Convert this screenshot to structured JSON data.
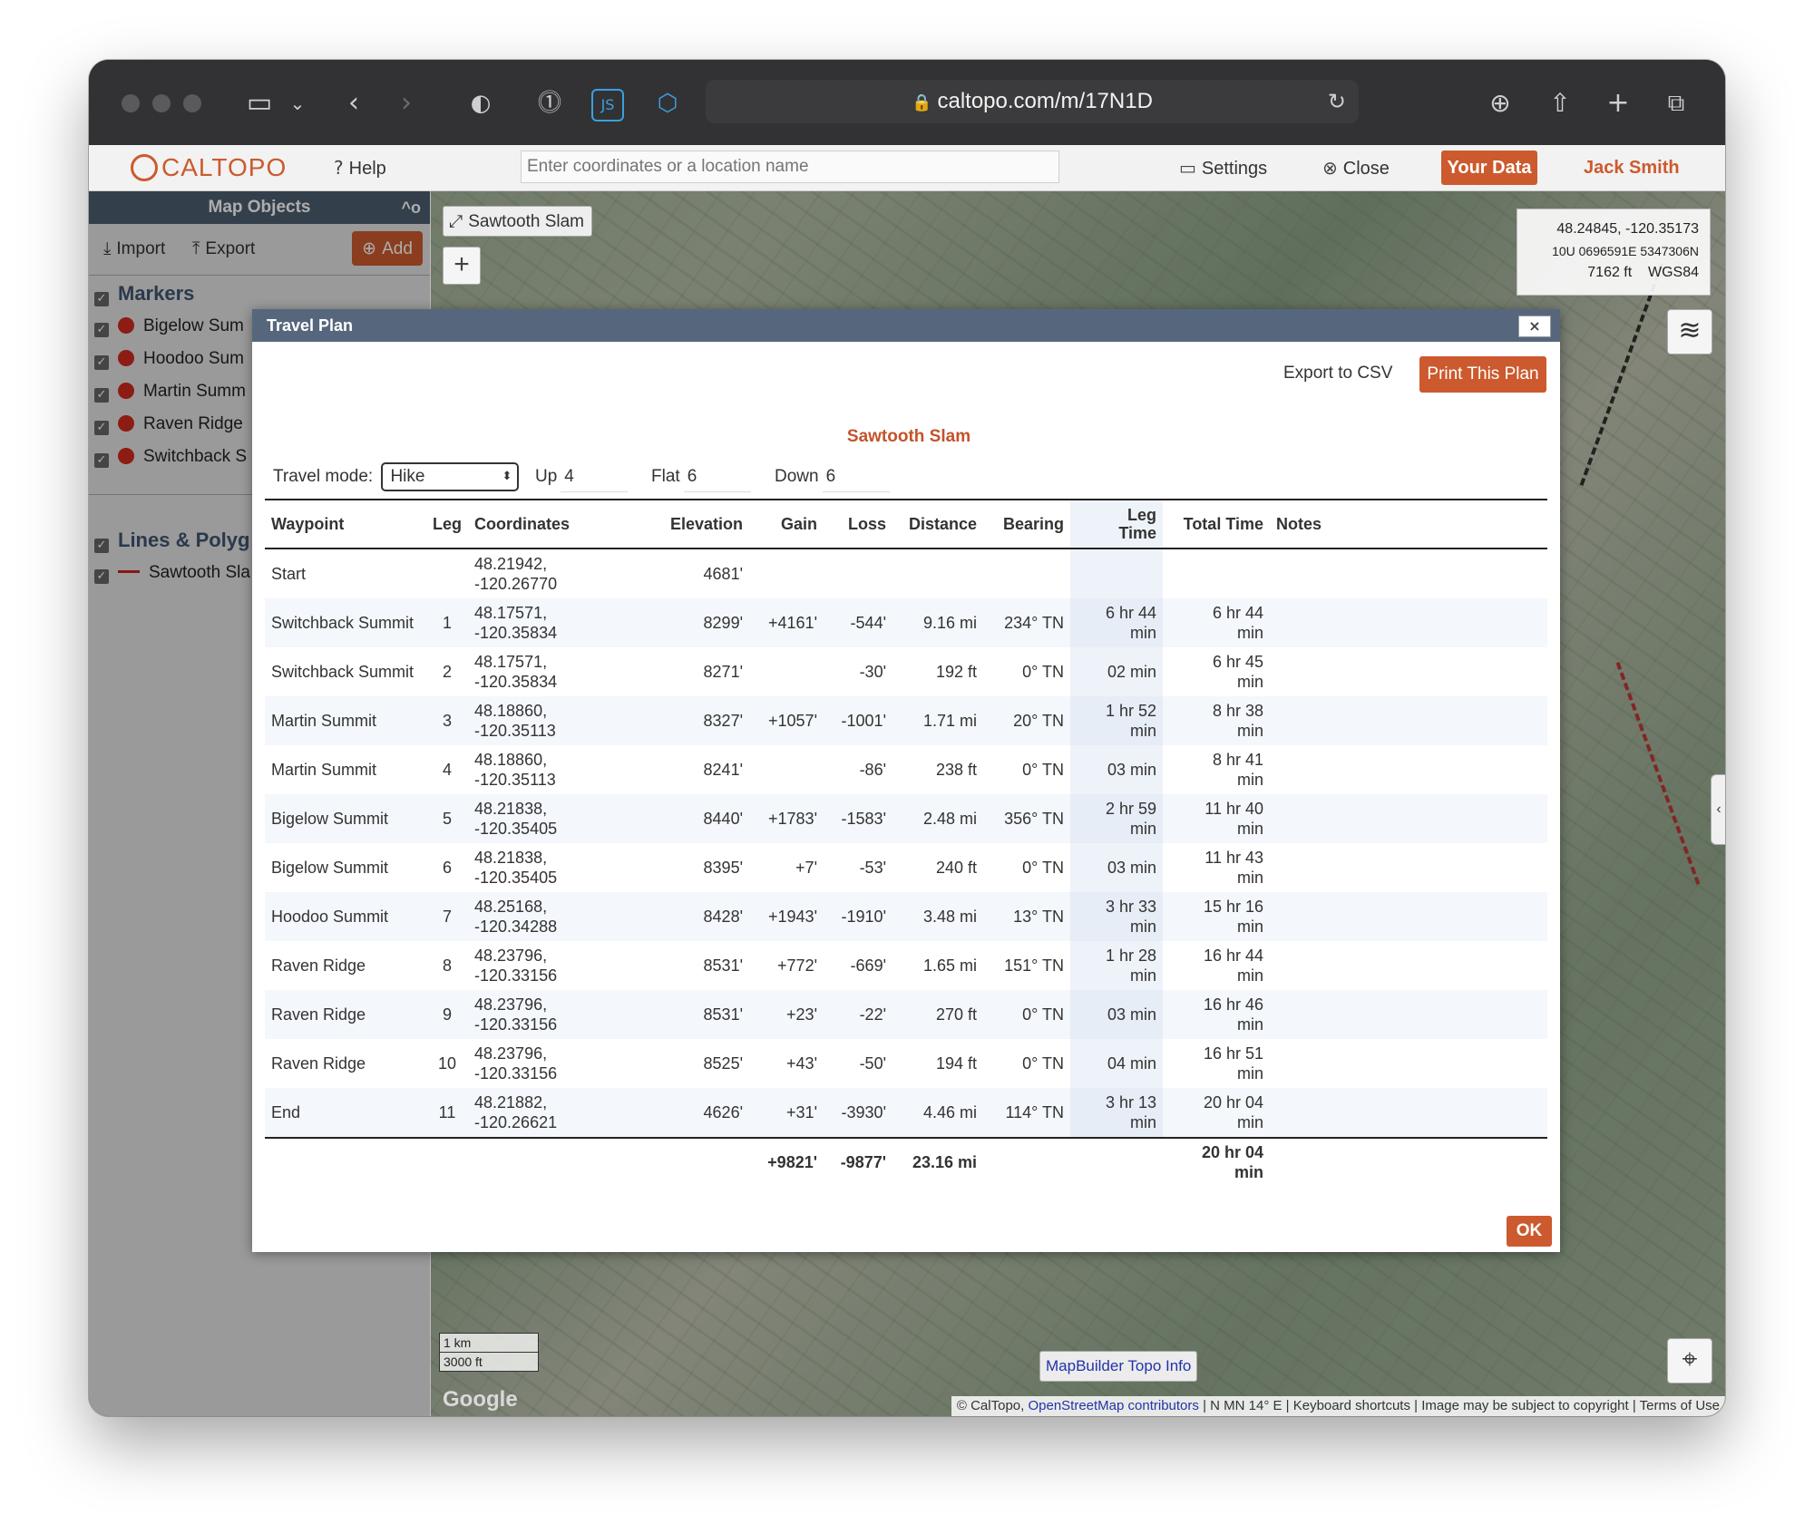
{
  "browser": {
    "url": "caltopo.com/m/17N1D"
  },
  "header": {
    "logo": "CALTOPO",
    "help": "Help",
    "search_placeholder": "Enter coordinates or a location name",
    "settings": "Settings",
    "close": "Close",
    "your_data": "Your Data",
    "user": "Jack Smith"
  },
  "sidebar": {
    "title": "Map Objects",
    "collapse": "^o",
    "import": "Import",
    "export": "Export",
    "add": "Add",
    "markers_heading": "Markers",
    "markers": [
      "Bigelow Sum",
      "Hoodoo Sum",
      "Martin Summ",
      "Raven Ridge",
      "Switchback S"
    ],
    "lines_heading": "Lines & Polyg",
    "lines": [
      "Sawtooth Sla"
    ]
  },
  "map": {
    "title_chip": "Sawtooth Slam",
    "zoom_in": "+",
    "coords": {
      "latlng": "48.24845, -120.35173",
      "utm": "10U 0696591E 5347306N",
      "elev": "7162 ft",
      "datum": "WGS84"
    },
    "scale_km": "1 km",
    "scale_ft": "3000 ft",
    "google": "Google",
    "mapbuilder": "MapBuilder Topo Info",
    "attribution": {
      "caltopo": "© CalTopo,",
      "osm": "OpenStreetMap contributors",
      "declination": "N MN 14° E",
      "keyboard": "Keyboard shortcuts",
      "copyright": "Image may be subject to copyright",
      "terms": "Terms of Use"
    }
  },
  "modal": {
    "title": "Travel Plan",
    "close": "×",
    "export_csv": "Export to CSV",
    "print": "Print This Plan",
    "plan_title": "Sawtooth Slam",
    "travel_mode_label": "Travel mode:",
    "travel_mode": "Hike",
    "up_label": "Up",
    "up": "4",
    "flat_label": "Flat",
    "flat": "6",
    "down_label": "Down",
    "down": "6",
    "ok": "OK",
    "columns": {
      "waypoint": "Waypoint",
      "leg": "Leg",
      "coordinates": "Coordinates",
      "elevation": "Elevation",
      "gain": "Gain",
      "loss": "Loss",
      "distance": "Distance",
      "bearing": "Bearing",
      "leg_time_1": "Leg",
      "leg_time_2": "Time",
      "total_time": "Total Time",
      "notes": "Notes"
    },
    "rows": [
      {
        "waypoint": "Start",
        "leg": "",
        "lat": "48.21942,",
        "lng": "-120.26770",
        "elev": "4681'",
        "gain": "",
        "loss": "",
        "dist": "",
        "bearing": "",
        "leg_time_1": "",
        "leg_time_2": "",
        "total_1": "",
        "total_2": ""
      },
      {
        "waypoint": "Switchback Summit",
        "leg": "1",
        "lat": "48.17571,",
        "lng": "-120.35834",
        "elev": "8299'",
        "gain": "+4161'",
        "loss": "-544'",
        "dist": "9.16 mi",
        "bearing": "234° TN",
        "leg_time_1": "6 hr 44",
        "leg_time_2": "min",
        "total_1": "6 hr 44",
        "total_2": "min"
      },
      {
        "waypoint": "Switchback Summit",
        "leg": "2",
        "lat": "48.17571,",
        "lng": "-120.35834",
        "elev": "8271'",
        "gain": "",
        "loss": "-30'",
        "dist": "192 ft",
        "bearing": "0° TN",
        "leg_time_1": "02 min",
        "leg_time_2": "",
        "total_1": "6 hr 45",
        "total_2": "min"
      },
      {
        "waypoint": "Martin Summit",
        "leg": "3",
        "lat": "48.18860,",
        "lng": "-120.35113",
        "elev": "8327'",
        "gain": "+1057'",
        "loss": "-1001'",
        "dist": "1.71 mi",
        "bearing": "20° TN",
        "leg_time_1": "1 hr 52",
        "leg_time_2": "min",
        "total_1": "8 hr 38",
        "total_2": "min"
      },
      {
        "waypoint": "Martin Summit",
        "leg": "4",
        "lat": "48.18860,",
        "lng": "-120.35113",
        "elev": "8241'",
        "gain": "",
        "loss": "-86'",
        "dist": "238 ft",
        "bearing": "0° TN",
        "leg_time_1": "03 min",
        "leg_time_2": "",
        "total_1": "8 hr 41",
        "total_2": "min"
      },
      {
        "waypoint": "Bigelow Summit",
        "leg": "5",
        "lat": "48.21838,",
        "lng": "-120.35405",
        "elev": "8440'",
        "gain": "+1783'",
        "loss": "-1583'",
        "dist": "2.48 mi",
        "bearing": "356° TN",
        "leg_time_1": "2 hr 59",
        "leg_time_2": "min",
        "total_1": "11 hr 40",
        "total_2": "min"
      },
      {
        "waypoint": "Bigelow Summit",
        "leg": "6",
        "lat": "48.21838,",
        "lng": "-120.35405",
        "elev": "8395'",
        "gain": "+7'",
        "loss": "-53'",
        "dist": "240 ft",
        "bearing": "0° TN",
        "leg_time_1": "03 min",
        "leg_time_2": "",
        "total_1": "11 hr 43",
        "total_2": "min"
      },
      {
        "waypoint": "Hoodoo Summit",
        "leg": "7",
        "lat": "48.25168,",
        "lng": "-120.34288",
        "elev": "8428'",
        "gain": "+1943'",
        "loss": "-1910'",
        "dist": "3.48 mi",
        "bearing": "13° TN",
        "leg_time_1": "3 hr 33",
        "leg_time_2": "min",
        "total_1": "15 hr 16",
        "total_2": "min"
      },
      {
        "waypoint": "Raven Ridge",
        "leg": "8",
        "lat": "48.23796,",
        "lng": "-120.33156",
        "elev": "8531'",
        "gain": "+772'",
        "loss": "-669'",
        "dist": "1.65 mi",
        "bearing": "151° TN",
        "leg_time_1": "1 hr 28",
        "leg_time_2": "min",
        "total_1": "16 hr 44",
        "total_2": "min"
      },
      {
        "waypoint": "Raven Ridge",
        "leg": "9",
        "lat": "48.23796,",
        "lng": "-120.33156",
        "elev": "8531'",
        "gain": "+23'",
        "loss": "-22'",
        "dist": "270 ft",
        "bearing": "0° TN",
        "leg_time_1": "03 min",
        "leg_time_2": "",
        "total_1": "16 hr 46",
        "total_2": "min"
      },
      {
        "waypoint": "Raven Ridge",
        "leg": "10",
        "lat": "48.23796,",
        "lng": "-120.33156",
        "elev": "8525'",
        "gain": "+43'",
        "loss": "-50'",
        "dist": "194 ft",
        "bearing": "0° TN",
        "leg_time_1": "04 min",
        "leg_time_2": "",
        "total_1": "16 hr 51",
        "total_2": "min"
      },
      {
        "waypoint": "End",
        "leg": "11",
        "lat": "48.21882,",
        "lng": "-120.26621",
        "elev": "4626'",
        "gain": "+31'",
        "loss": "-3930'",
        "dist": "4.46 mi",
        "bearing": "114° TN",
        "leg_time_1": "3 hr 13",
        "leg_time_2": "min",
        "total_1": "20 hr 04",
        "total_2": "min"
      }
    ],
    "totals": {
      "gain": "+9821'",
      "loss": "-9877'",
      "dist": "23.16 mi",
      "time_1": "20 hr 04",
      "time_2": "min"
    }
  }
}
